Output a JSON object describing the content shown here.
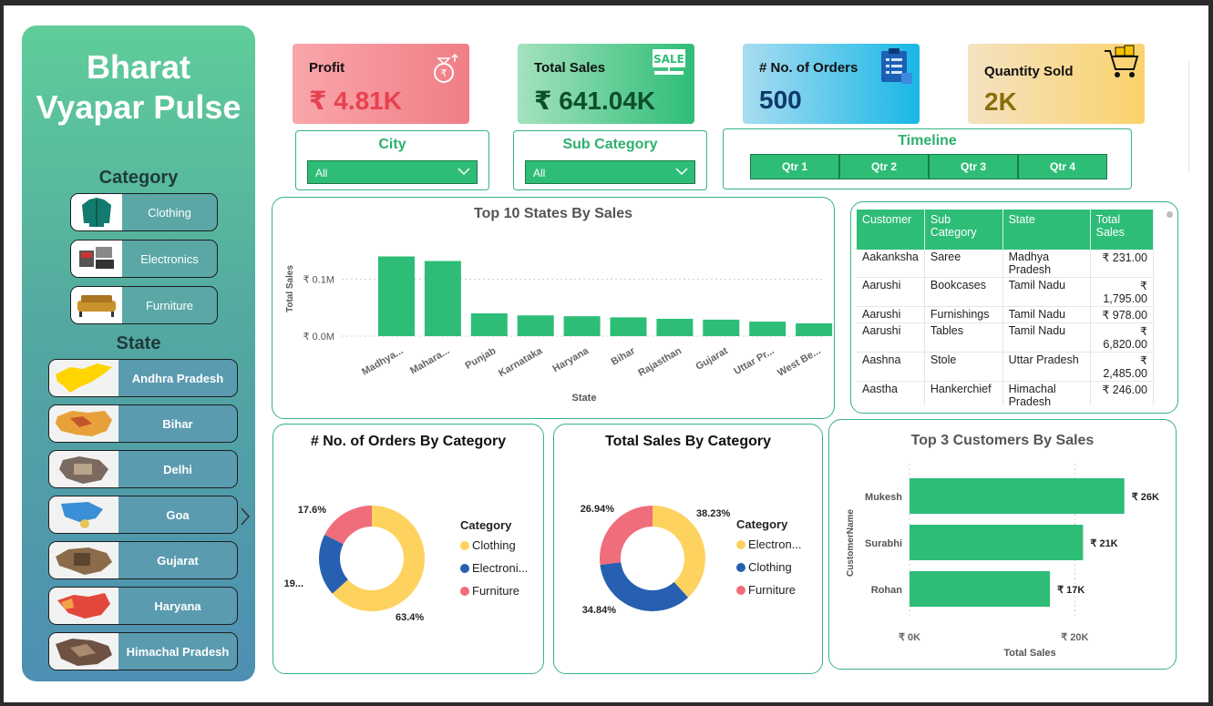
{
  "app": {
    "title_line1": "Bharat",
    "title_line2": "Vyapar Pulse"
  },
  "sidebar": {
    "category_title": "Category",
    "categories": [
      {
        "label": "Clothing"
      },
      {
        "label": "Electronics"
      },
      {
        "label": "Furniture"
      }
    ],
    "state_title": "State",
    "states": [
      {
        "label": "Andhra Pradesh"
      },
      {
        "label": "Bihar"
      },
      {
        "label": "Delhi"
      },
      {
        "label": "Goa"
      },
      {
        "label": "Gujarat"
      },
      {
        "label": "Haryana"
      },
      {
        "label": "Himachal Pradesh"
      }
    ],
    "scroll_icon": "chevron-right-icon"
  },
  "kpis": [
    {
      "label": "Profit",
      "value": "₹ 4.81K",
      "icon": "money-bag-icon",
      "color": "#e8414f"
    },
    {
      "label": "Total Sales",
      "value": "₹ 641.04K",
      "icon": "sale-sign-icon",
      "color": "#0d4f2b"
    },
    {
      "label": "# No. of Orders",
      "value": "500",
      "icon": "clipboard-icon",
      "color": "#0f3a6b"
    },
    {
      "label": "Quantity Sold",
      "value": "2K",
      "icon": "shopping-cart-icon",
      "color": "#8a6d0b"
    }
  ],
  "sale_icon_text": "SALE",
  "filters": {
    "city": {
      "title": "City",
      "value": "All"
    },
    "sub_category": {
      "title": "Sub Category",
      "value": "All"
    },
    "timeline": {
      "title": "Timeline",
      "quarters": [
        "Qtr 1",
        "Qtr 2",
        "Qtr 3",
        "Qtr 4"
      ]
    }
  },
  "customer_table": {
    "headers": [
      "Customer",
      "Sub Category",
      "State",
      "Total Sales"
    ],
    "rows": [
      [
        "Aakanksha",
        "Saree",
        "Madhya Pradesh",
        "₹ 231.00"
      ],
      [
        "Aarushi",
        "Bookcases",
        "Tamil Nadu",
        "₹ 1,795.00"
      ],
      [
        "Aarushi",
        "Furnishings",
        "Tamil Nadu",
        "₹ 978.00"
      ],
      [
        "Aarushi",
        "Tables",
        "Tamil Nadu",
        "₹ 6,820.00"
      ],
      [
        "Aashna",
        "Stole",
        "Uttar Pradesh",
        "₹ 2,485.00"
      ],
      [
        "Aastha",
        "Hankerchief",
        "Himachal Pradesh",
        "₹ 246.00"
      ]
    ]
  },
  "chart_data": [
    {
      "type": "bar",
      "title": "Top 10 States By Sales",
      "xlabel": "State",
      "ylabel": "Total Sales",
      "categories": [
        "Madhya...",
        "Mahara...",
        "Punjab",
        "Karnataka",
        "Haryana",
        "Bihar",
        "Rajasthan",
        "Gujarat",
        "Uttar Pr...",
        "West Be..."
      ],
      "values": [
        140000,
        132000,
        40000,
        36500,
        35000,
        33000,
        30500,
        29000,
        25500,
        22500
      ],
      "yticks": [
        "₹ 0.0M",
        "₹ 0.1M"
      ],
      "ylim": [
        0,
        160000
      ],
      "grid": true,
      "color": "#2ebd77"
    },
    {
      "type": "pie",
      "title": "# No. of Orders By Category",
      "legend_title": "Category",
      "labels": [
        "Clothing",
        "Electroni...",
        "Furniture"
      ],
      "values": [
        63.4,
        19,
        17.6
      ],
      "data_labels": [
        "63.4%",
        "19...",
        "17.6%"
      ],
      "colors": [
        "#fdd25f",
        "#2760b0",
        "#f06d7c"
      ],
      "legend_position": "right"
    },
    {
      "type": "pie",
      "title": "Total Sales By Category",
      "legend_title": "Category",
      "labels": [
        "Electron...",
        "Clothing",
        "Furniture"
      ],
      "values": [
        38.23,
        34.84,
        26.94
      ],
      "data_labels": [
        "38.23%",
        "34.84%",
        "26.94%"
      ],
      "colors": [
        "#fdd25f",
        "#2760b0",
        "#f06d7c"
      ],
      "legend_position": "right"
    },
    {
      "type": "bar",
      "orientation": "horizontal",
      "title": "Top 3 Customers By Sales",
      "xlabel": "Total Sales",
      "ylabel": "CustomerName",
      "categories": [
        "Mukesh",
        "Surabhi",
        "Rohan"
      ],
      "values": [
        26000,
        21000,
        17000
      ],
      "data_labels": [
        "₹ 26K",
        "₹ 21K",
        "₹ 17K"
      ],
      "xticks": [
        "₹ 0K",
        "₹ 20K"
      ],
      "xlim": [
        0,
        30000
      ],
      "grid": true,
      "color": "#2ebd77"
    }
  ]
}
